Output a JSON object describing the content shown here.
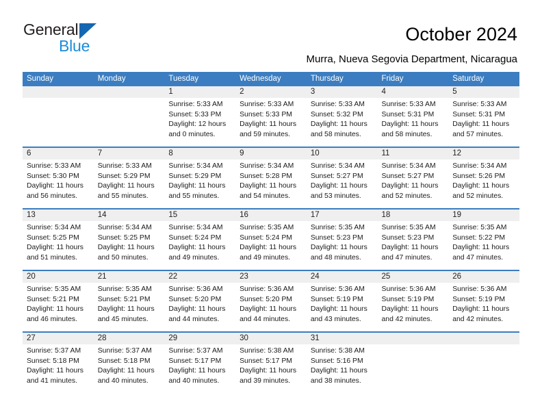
{
  "brand": {
    "word1": "General",
    "word2": "Blue",
    "triangle_color": "#1567b2",
    "blue_color": "#1a8cdb"
  },
  "header": {
    "title": "October 2024",
    "subtitle": "Murra, Nueva Segovia Department, Nicaragua"
  },
  "calendar": {
    "header_bg": "#3b7dc0",
    "daynum_bg": "#efefef",
    "weekdays": [
      "Sunday",
      "Monday",
      "Tuesday",
      "Wednesday",
      "Thursday",
      "Friday",
      "Saturday"
    ],
    "weeks": [
      [
        {
          "day": "",
          "lines": []
        },
        {
          "day": "",
          "lines": []
        },
        {
          "day": "1",
          "lines": [
            "Sunrise: 5:33 AM",
            "Sunset: 5:33 PM",
            "Daylight: 12 hours",
            "and 0 minutes."
          ]
        },
        {
          "day": "2",
          "lines": [
            "Sunrise: 5:33 AM",
            "Sunset: 5:33 PM",
            "Daylight: 11 hours",
            "and 59 minutes."
          ]
        },
        {
          "day": "3",
          "lines": [
            "Sunrise: 5:33 AM",
            "Sunset: 5:32 PM",
            "Daylight: 11 hours",
            "and 58 minutes."
          ]
        },
        {
          "day": "4",
          "lines": [
            "Sunrise: 5:33 AM",
            "Sunset: 5:31 PM",
            "Daylight: 11 hours",
            "and 58 minutes."
          ]
        },
        {
          "day": "5",
          "lines": [
            "Sunrise: 5:33 AM",
            "Sunset: 5:31 PM",
            "Daylight: 11 hours",
            "and 57 minutes."
          ]
        }
      ],
      [
        {
          "day": "6",
          "lines": [
            "Sunrise: 5:33 AM",
            "Sunset: 5:30 PM",
            "Daylight: 11 hours",
            "and 56 minutes."
          ]
        },
        {
          "day": "7",
          "lines": [
            "Sunrise: 5:33 AM",
            "Sunset: 5:29 PM",
            "Daylight: 11 hours",
            "and 55 minutes."
          ]
        },
        {
          "day": "8",
          "lines": [
            "Sunrise: 5:34 AM",
            "Sunset: 5:29 PM",
            "Daylight: 11 hours",
            "and 55 minutes."
          ]
        },
        {
          "day": "9",
          "lines": [
            "Sunrise: 5:34 AM",
            "Sunset: 5:28 PM",
            "Daylight: 11 hours",
            "and 54 minutes."
          ]
        },
        {
          "day": "10",
          "lines": [
            "Sunrise: 5:34 AM",
            "Sunset: 5:27 PM",
            "Daylight: 11 hours",
            "and 53 minutes."
          ]
        },
        {
          "day": "11",
          "lines": [
            "Sunrise: 5:34 AM",
            "Sunset: 5:27 PM",
            "Daylight: 11 hours",
            "and 52 minutes."
          ]
        },
        {
          "day": "12",
          "lines": [
            "Sunrise: 5:34 AM",
            "Sunset: 5:26 PM",
            "Daylight: 11 hours",
            "and 52 minutes."
          ]
        }
      ],
      [
        {
          "day": "13",
          "lines": [
            "Sunrise: 5:34 AM",
            "Sunset: 5:25 PM",
            "Daylight: 11 hours",
            "and 51 minutes."
          ]
        },
        {
          "day": "14",
          "lines": [
            "Sunrise: 5:34 AM",
            "Sunset: 5:25 PM",
            "Daylight: 11 hours",
            "and 50 minutes."
          ]
        },
        {
          "day": "15",
          "lines": [
            "Sunrise: 5:34 AM",
            "Sunset: 5:24 PM",
            "Daylight: 11 hours",
            "and 49 minutes."
          ]
        },
        {
          "day": "16",
          "lines": [
            "Sunrise: 5:35 AM",
            "Sunset: 5:24 PM",
            "Daylight: 11 hours",
            "and 49 minutes."
          ]
        },
        {
          "day": "17",
          "lines": [
            "Sunrise: 5:35 AM",
            "Sunset: 5:23 PM",
            "Daylight: 11 hours",
            "and 48 minutes."
          ]
        },
        {
          "day": "18",
          "lines": [
            "Sunrise: 5:35 AM",
            "Sunset: 5:23 PM",
            "Daylight: 11 hours",
            "and 47 minutes."
          ]
        },
        {
          "day": "19",
          "lines": [
            "Sunrise: 5:35 AM",
            "Sunset: 5:22 PM",
            "Daylight: 11 hours",
            "and 47 minutes."
          ]
        }
      ],
      [
        {
          "day": "20",
          "lines": [
            "Sunrise: 5:35 AM",
            "Sunset: 5:21 PM",
            "Daylight: 11 hours",
            "and 46 minutes."
          ]
        },
        {
          "day": "21",
          "lines": [
            "Sunrise: 5:35 AM",
            "Sunset: 5:21 PM",
            "Daylight: 11 hours",
            "and 45 minutes."
          ]
        },
        {
          "day": "22",
          "lines": [
            "Sunrise: 5:36 AM",
            "Sunset: 5:20 PM",
            "Daylight: 11 hours",
            "and 44 minutes."
          ]
        },
        {
          "day": "23",
          "lines": [
            "Sunrise: 5:36 AM",
            "Sunset: 5:20 PM",
            "Daylight: 11 hours",
            "and 44 minutes."
          ]
        },
        {
          "day": "24",
          "lines": [
            "Sunrise: 5:36 AM",
            "Sunset: 5:19 PM",
            "Daylight: 11 hours",
            "and 43 minutes."
          ]
        },
        {
          "day": "25",
          "lines": [
            "Sunrise: 5:36 AM",
            "Sunset: 5:19 PM",
            "Daylight: 11 hours",
            "and 42 minutes."
          ]
        },
        {
          "day": "26",
          "lines": [
            "Sunrise: 5:36 AM",
            "Sunset: 5:19 PM",
            "Daylight: 11 hours",
            "and 42 minutes."
          ]
        }
      ],
      [
        {
          "day": "27",
          "lines": [
            "Sunrise: 5:37 AM",
            "Sunset: 5:18 PM",
            "Daylight: 11 hours",
            "and 41 minutes."
          ]
        },
        {
          "day": "28",
          "lines": [
            "Sunrise: 5:37 AM",
            "Sunset: 5:18 PM",
            "Daylight: 11 hours",
            "and 40 minutes."
          ]
        },
        {
          "day": "29",
          "lines": [
            "Sunrise: 5:37 AM",
            "Sunset: 5:17 PM",
            "Daylight: 11 hours",
            "and 40 minutes."
          ]
        },
        {
          "day": "30",
          "lines": [
            "Sunrise: 5:38 AM",
            "Sunset: 5:17 PM",
            "Daylight: 11 hours",
            "and 39 minutes."
          ]
        },
        {
          "day": "31",
          "lines": [
            "Sunrise: 5:38 AM",
            "Sunset: 5:16 PM",
            "Daylight: 11 hours",
            "and 38 minutes."
          ]
        },
        {
          "day": "",
          "lines": []
        },
        {
          "day": "",
          "lines": []
        }
      ]
    ]
  }
}
